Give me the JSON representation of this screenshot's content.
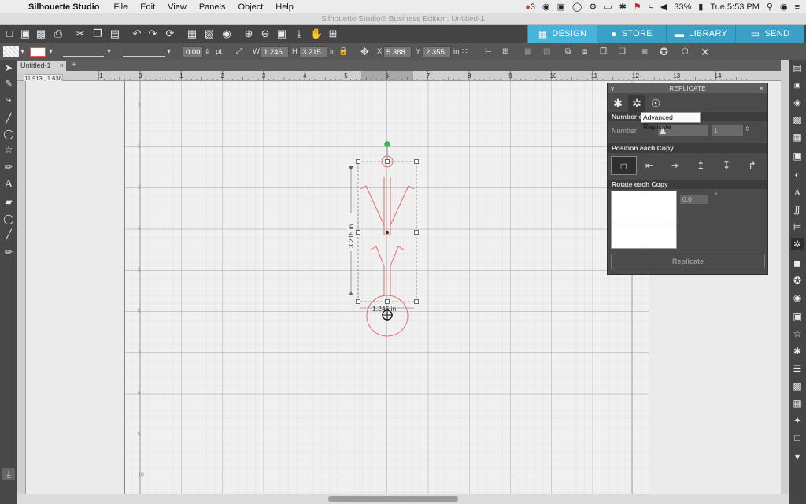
{
  "menubar": {
    "app_name": "Silhouette Studio",
    "items": [
      "File",
      "Edit",
      "View",
      "Panels",
      "Object",
      "Help"
    ],
    "status_badge": "3",
    "battery": "33%",
    "clock": "Tue 5:53 PM"
  },
  "window": {
    "title": "Silhouette Studio® Business Edition: Untitled-1"
  },
  "nav_tabs": [
    {
      "label": "DESIGN",
      "icon": "grid-icon"
    },
    {
      "label": "STORE",
      "icon": "globe-icon"
    },
    {
      "label": "LIBRARY",
      "icon": "library-icon"
    },
    {
      "label": "SEND",
      "icon": "cutter-icon"
    }
  ],
  "toolbar2": {
    "line_weight": "0.00",
    "line_unit": "pt",
    "width_label": "W",
    "width_value": "1.246",
    "height_label": "H",
    "height_value": "3.215",
    "size_unit": "in",
    "x_label": "X",
    "x_value": "5.388",
    "y_label": "Y",
    "y_value": "2.355",
    "pos_unit": "in"
  },
  "document": {
    "tab_name": "Untitled-1",
    "tab_close": "×",
    "add_tab": "+",
    "cursor_coords": "11.913 , 1.636"
  },
  "ruler": {
    "top_labels": [
      "-1",
      "0",
      "1",
      "2",
      "3",
      "4",
      "5",
      "6",
      "7",
      "8",
      "9",
      "10",
      "11",
      "12",
      "13",
      "14"
    ],
    "left_labels": [
      "1",
      "2",
      "3",
      "4",
      "5",
      "6",
      "7",
      "8",
      "9",
      "10"
    ]
  },
  "selection": {
    "height_label": "3.215 in",
    "width_label": "1.246 in"
  },
  "replicate_panel": {
    "title": "REPLICATE",
    "tooltip": "Advanced Replicate",
    "number_of_copies_header": "Number of Copies",
    "number_label": "Number",
    "number_value": "1",
    "position_header": "Position each Copy",
    "rotate_header": "Rotate each Copy",
    "rotate_value": "0.0",
    "rotate_unit": "°",
    "replicate_button": "Replicate"
  },
  "colors": {
    "accent": "#49b4d9",
    "shape_stroke": "#e96a6a",
    "rotation_point": "#2ecc40"
  }
}
